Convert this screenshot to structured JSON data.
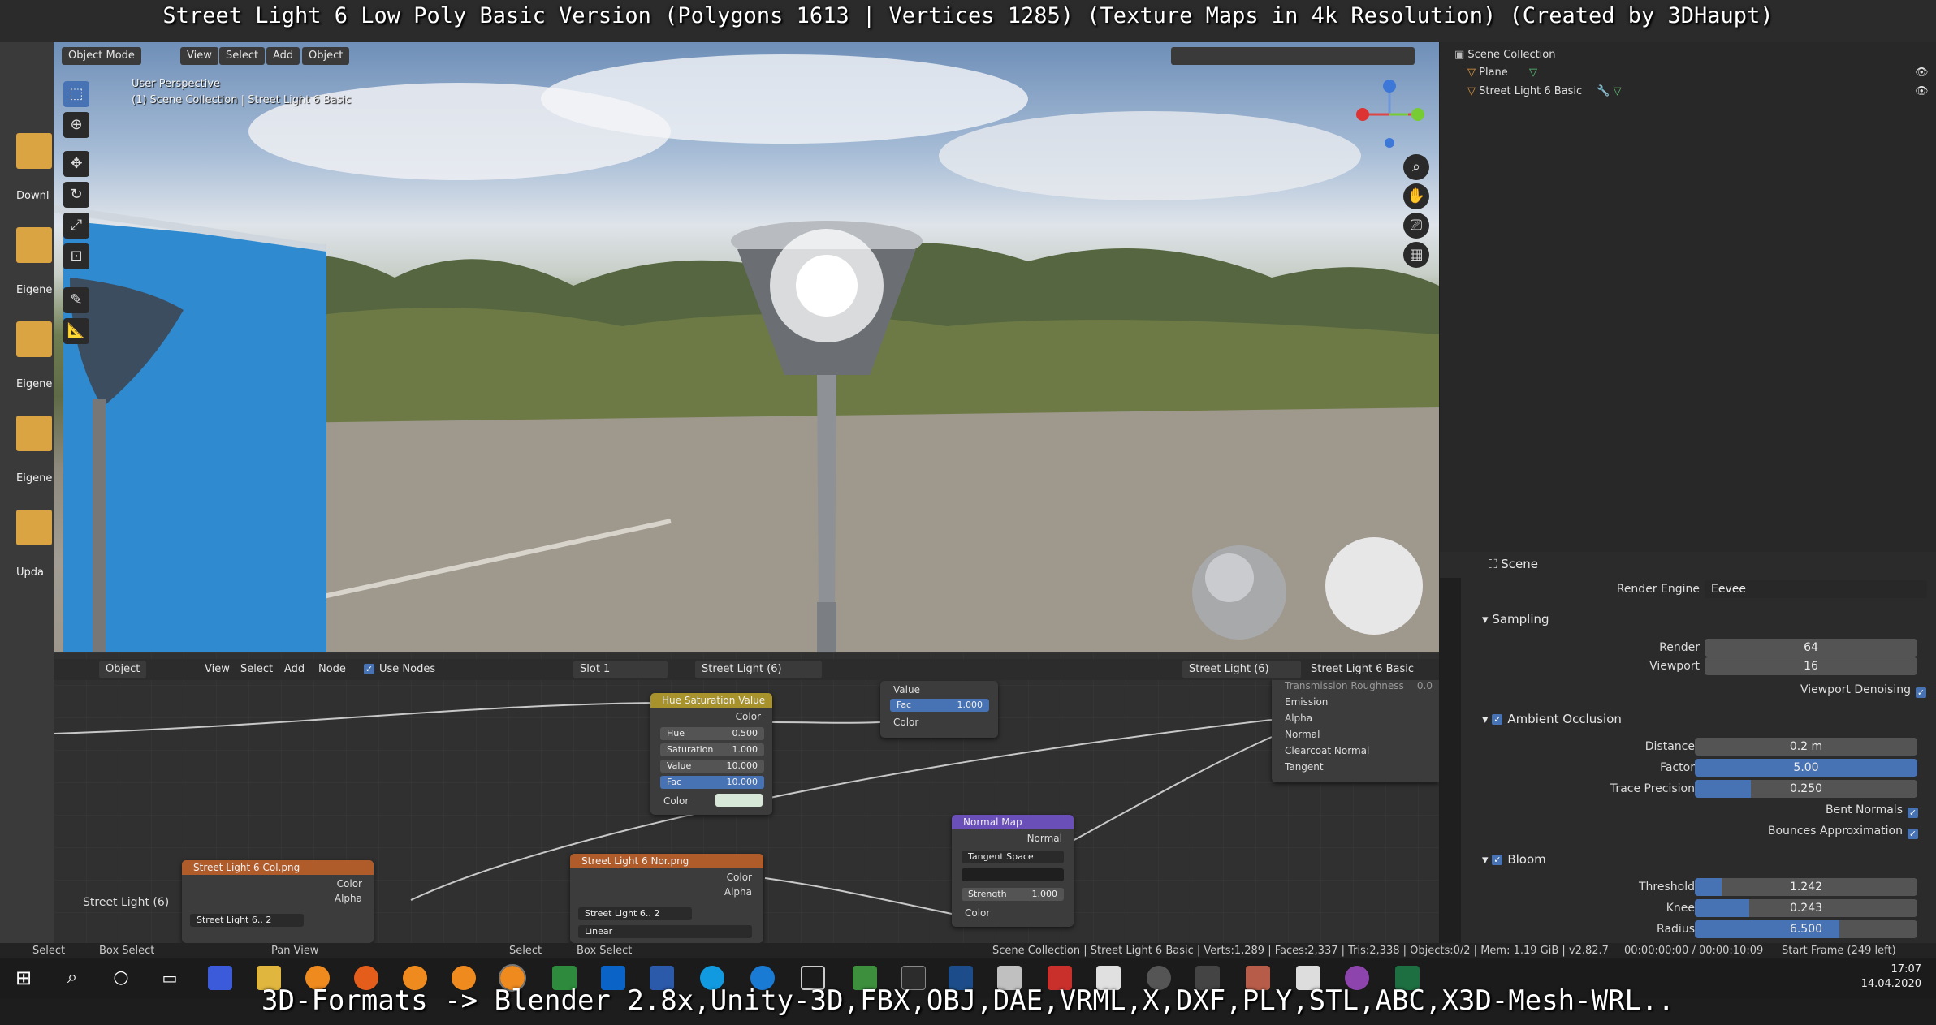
{
  "banner_top": "Street Light 6 Low Poly Basic Version (Polygons 1613 | Vertices 1285) (Texture Maps in 4k Resolution) (Created by 3DHaupt)",
  "banner_bottom": "3D-Formats -> Blender 2.8x,Unity-3D,FBX,OBJ,DAE,VRML,X,DXF,PLY,STL,ABC,X3D-Mesh-WRL..",
  "desktop": {
    "items": [
      "Downl",
      "Eigene I",
      "Eigene I",
      "Eigene V",
      "Upda"
    ]
  },
  "viewport": {
    "mode": "Object Mode",
    "menus": [
      "View",
      "Select",
      "Add",
      "Object"
    ],
    "perspective": "User Perspective",
    "collection_info": "(1) Scene Collection | Street Light 6 Basic"
  },
  "outliner": {
    "root": "Scene Collection",
    "items": [
      "Plane",
      "Street Light 6 Basic"
    ]
  },
  "properties": {
    "context": "Scene",
    "render_engine_label": "Render Engine",
    "render_engine": "Eevee",
    "sampling": {
      "title": "Sampling",
      "render_label": "Render",
      "render": "64",
      "viewport_label": "Viewport",
      "viewport": "16",
      "denoise_label": "Viewport Denoising"
    },
    "ao": {
      "title": "Ambient Occlusion",
      "distance_label": "Distance",
      "distance": "0.2 m",
      "factor_label": "Factor",
      "factor": "5.00",
      "trace_label": "Trace Precision",
      "trace": "0.250",
      "trace_fill": 0.25,
      "bent_label": "Bent Normals",
      "bounce_label": "Bounces Approximation"
    },
    "bloom": {
      "title": "Bloom",
      "threshold_label": "Threshold",
      "threshold": "1.242",
      "threshold_fill": 0.12,
      "knee_label": "Knee",
      "knee": "0.243",
      "knee_fill": 0.243,
      "radius_label": "Radius",
      "radius": "6.500",
      "radius_fill": 0.65
    }
  },
  "node_editor": {
    "type": "Object",
    "menus": [
      "View",
      "Select",
      "Add",
      "Node"
    ],
    "use_nodes": "Use Nodes",
    "slot": "Slot 1",
    "material": "Street Light (6)",
    "object_material": "Street Light (6)",
    "object_name": "Street Light 6 Basic",
    "frame_label": "Street Light (6)",
    "hsv": {
      "title": "Hue Saturation Value",
      "out_color": "Color",
      "hue_label": "Hue",
      "hue": "0.500",
      "sat_label": "Saturation",
      "sat": "1.000",
      "val_label": "Value",
      "val": "10.000",
      "fac_label": "Fac",
      "fac": "10.000",
      "color_label": "Color"
    },
    "mix": {
      "value": "Value",
      "fac_label": "Fac",
      "fac": "1.000",
      "color": "Color"
    },
    "bsdf_inputs": [
      "Transmission Roughness",
      "Emission",
      "Alpha",
      "Normal",
      "Clearcoat Normal",
      "Tangent"
    ],
    "bsdf_value": "0.0",
    "normal_map": {
      "title": "Normal Map",
      "out": "Normal",
      "space": "Tangent Space",
      "strength_label": "Strength",
      "strength": "1.000",
      "color": "Color"
    },
    "col_tex": {
      "title": "Street Light 6 Col.png",
      "color": "Color",
      "alpha": "Alpha",
      "name": "Street Light 6..",
      "users": "2"
    },
    "nor_tex": {
      "title": "Street Light 6 Nor.png",
      "color": "Color",
      "alpha": "Alpha",
      "name": "Street Light 6..",
      "users": "2",
      "interp": "Linear"
    }
  },
  "status": {
    "select": "Select",
    "box_select": "Box Select",
    "pan_view": "Pan View",
    "select2": "Select",
    "box_select2": "Box Select",
    "info": "Scene Collection | Street Light 6 Basic | Verts:1,289 | Faces:2,337 | Tris:2,338 | Objects:0/2 | Mem: 1.19 GiB | v2.82.7",
    "time": "00:00:00:00 / 00:00:10:09",
    "frame": "Start Frame (249 left)"
  },
  "clock": {
    "time": "17:07",
    "date": "14.04.2020"
  }
}
